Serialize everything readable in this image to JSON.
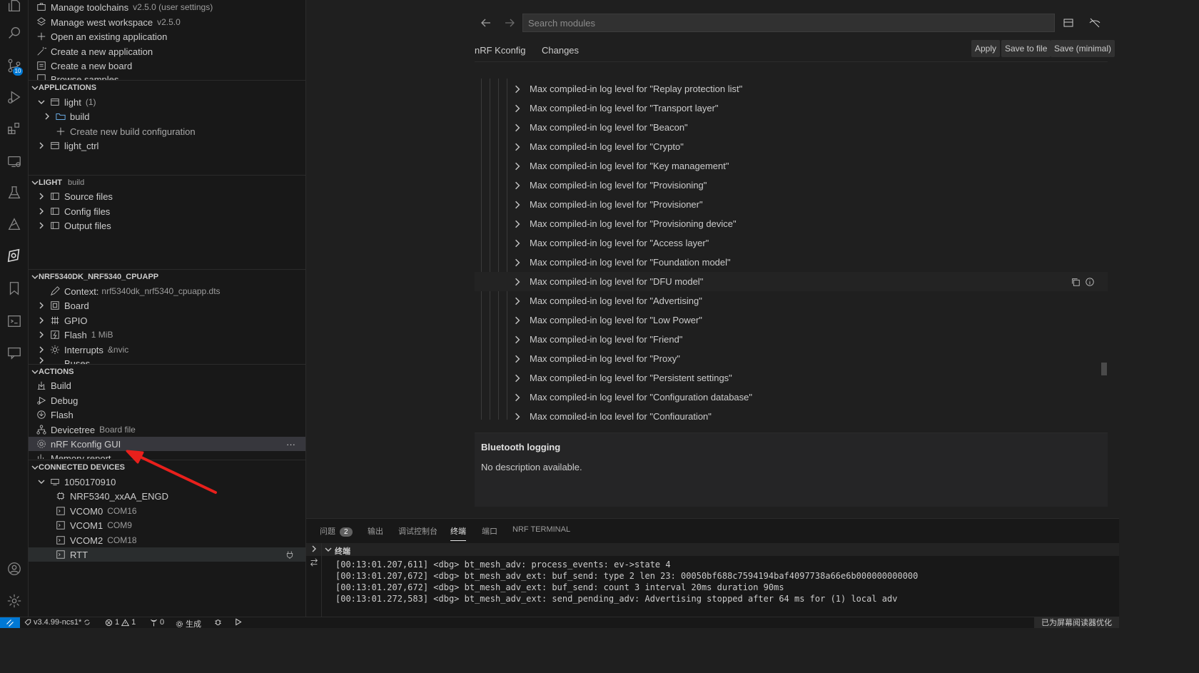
{
  "activity_bar": {
    "items": [
      "explorer-icon",
      "search-icon",
      "source-control-icon",
      "run-debug-icon",
      "extensions-icon",
      "remote-explorer-icon",
      "testing-icon",
      "nrf-connect-icon",
      "nrf-kconfig-icon",
      "bookmarks-icon",
      "terminal-icon",
      "chat-icon"
    ],
    "source_control_badge": "10",
    "bottom": [
      "account-icon",
      "settings-gear-icon"
    ]
  },
  "sidebar": {
    "welcome_items": [
      {
        "label": "Manage toolchains",
        "desc": "v2.5.0 (user settings)",
        "icon": "toolbox-icon"
      },
      {
        "label": "Manage west workspace",
        "desc": "v2.5.0",
        "icon": "workspace-icon"
      },
      {
        "label": "Open an existing application",
        "desc": "",
        "icon": "plus-icon"
      },
      {
        "label": "Create a new application",
        "desc": "",
        "icon": "wand-icon"
      },
      {
        "label": "Create a new board",
        "desc": "",
        "icon": "board-icon"
      },
      {
        "label": "Browse samples",
        "desc": "",
        "icon": "samples-icon"
      }
    ],
    "applications": {
      "header": "APPLICATIONS",
      "items": [
        {
          "label": "light",
          "desc": "(1)",
          "expanded": true
        },
        {
          "label": "build",
          "desc": ""
        },
        {
          "label": "Create new build configuration",
          "desc": ""
        },
        {
          "label": "light_ctrl",
          "desc": ""
        }
      ]
    },
    "light": {
      "header": "LIGHT",
      "header_desc": "build",
      "items": [
        "Source files",
        "Config files",
        "Output files"
      ]
    },
    "devicetree": {
      "header": "NRF5340DK_NRF5340_CPUAPP",
      "items": [
        {
          "label": "Context:",
          "desc": "nrf5340dk_nrf5340_cpuapp.dts"
        },
        {
          "label": "Board",
          "desc": ""
        },
        {
          "label": "GPIO",
          "desc": ""
        },
        {
          "label": "Flash",
          "desc": "1 MiB"
        },
        {
          "label": "Interrupts",
          "desc": "&nvic"
        },
        {
          "label": "Buses",
          "desc": ""
        }
      ]
    },
    "actions": {
      "header": "ACTIONS",
      "items": [
        {
          "label": "Build",
          "desc": ""
        },
        {
          "label": "Debug",
          "desc": ""
        },
        {
          "label": "Flash",
          "desc": ""
        },
        {
          "label": "Devicetree",
          "desc": "Board file"
        },
        {
          "label": "nRF Kconfig GUI",
          "desc": ""
        },
        {
          "label": "Memory report",
          "desc": ""
        }
      ],
      "more": "···"
    },
    "connected_devices": {
      "header": "CONNECTED DEVICES",
      "items": [
        {
          "label": "1050170910",
          "desc": ""
        },
        {
          "label": "NRF5340_xxAA_ENGD",
          "desc": ""
        },
        {
          "label": "VCOM0",
          "desc": "COM16"
        },
        {
          "label": "VCOM1",
          "desc": "COM9"
        },
        {
          "label": "VCOM2",
          "desc": "COM18"
        },
        {
          "label": "RTT",
          "desc": ""
        }
      ]
    }
  },
  "editor": {
    "search_placeholder": "Search modules",
    "tabs": [
      "nRF Kconfig",
      "Changes"
    ],
    "buttons": [
      "Apply",
      "Save to file",
      "Save (minimal)"
    ],
    "options": [
      "Max compiled-in log level for \"Replay protection list\"",
      "Max compiled-in log level for \"Transport layer\"",
      "Max compiled-in log level for \"Beacon\"",
      "Max compiled-in log level for \"Crypto\"",
      "Max compiled-in log level for \"Key management\"",
      "Max compiled-in log level for \"Provisioning\"",
      "Max compiled-in log level for \"Provisioner\"",
      "Max compiled-in log level for \"Provisioning device\"",
      "Max compiled-in log level for \"Access layer\"",
      "Max compiled-in log level for \"Foundation model\"",
      "Max compiled-in log level for \"DFU model\"",
      "Max compiled-in log level for \"Advertising\"",
      "Max compiled-in log level for \"Low Power\"",
      "Max compiled-in log level for \"Friend\"",
      "Max compiled-in log level for \"Proxy\"",
      "Max compiled-in log level for \"Persistent settings\"",
      "Max compiled-in log level for \"Configuration database\"",
      "Max compiled-in log level for \"Configuration\""
    ],
    "description": {
      "title": "Bluetooth logging",
      "text": "No description available."
    }
  },
  "panel": {
    "tabs": [
      "问题",
      "输出",
      "调试控制台",
      "终端",
      "端口",
      "NRF TERMINAL"
    ],
    "problems_count": "2",
    "active_tab": "终端",
    "terminal_header": "终端",
    "lines": [
      "[00:13:01.207,611] <dbg> bt_mesh_adv: process_events: ev->state 4",
      "[00:13:01.207,672] <dbg> bt_mesh_adv_ext: buf_send: type 2 len 23: 00050bf688c7594194baf4097738a66e6b000000000000",
      "[00:13:01.207,672] <dbg> bt_mesh_adv_ext: buf_send: count 3 interval 20ms duration 90ms",
      "[00:13:01.272,583] <dbg> bt_mesh_adv_ext: send_pending_adv: Advertising stopped after 64 ms for (1) local adv"
    ]
  },
  "statusbar": {
    "sdk": "v3.4.99-ncs1*",
    "errors": "1",
    "warnings": "1",
    "ports": "0",
    "build": "生成",
    "right": "已为屏幕阅读器优化"
  },
  "colors": {
    "accent": "#0078d4",
    "arrow": "#e8201c",
    "background": "#181818",
    "editor_bg": "#1f1f1f"
  }
}
